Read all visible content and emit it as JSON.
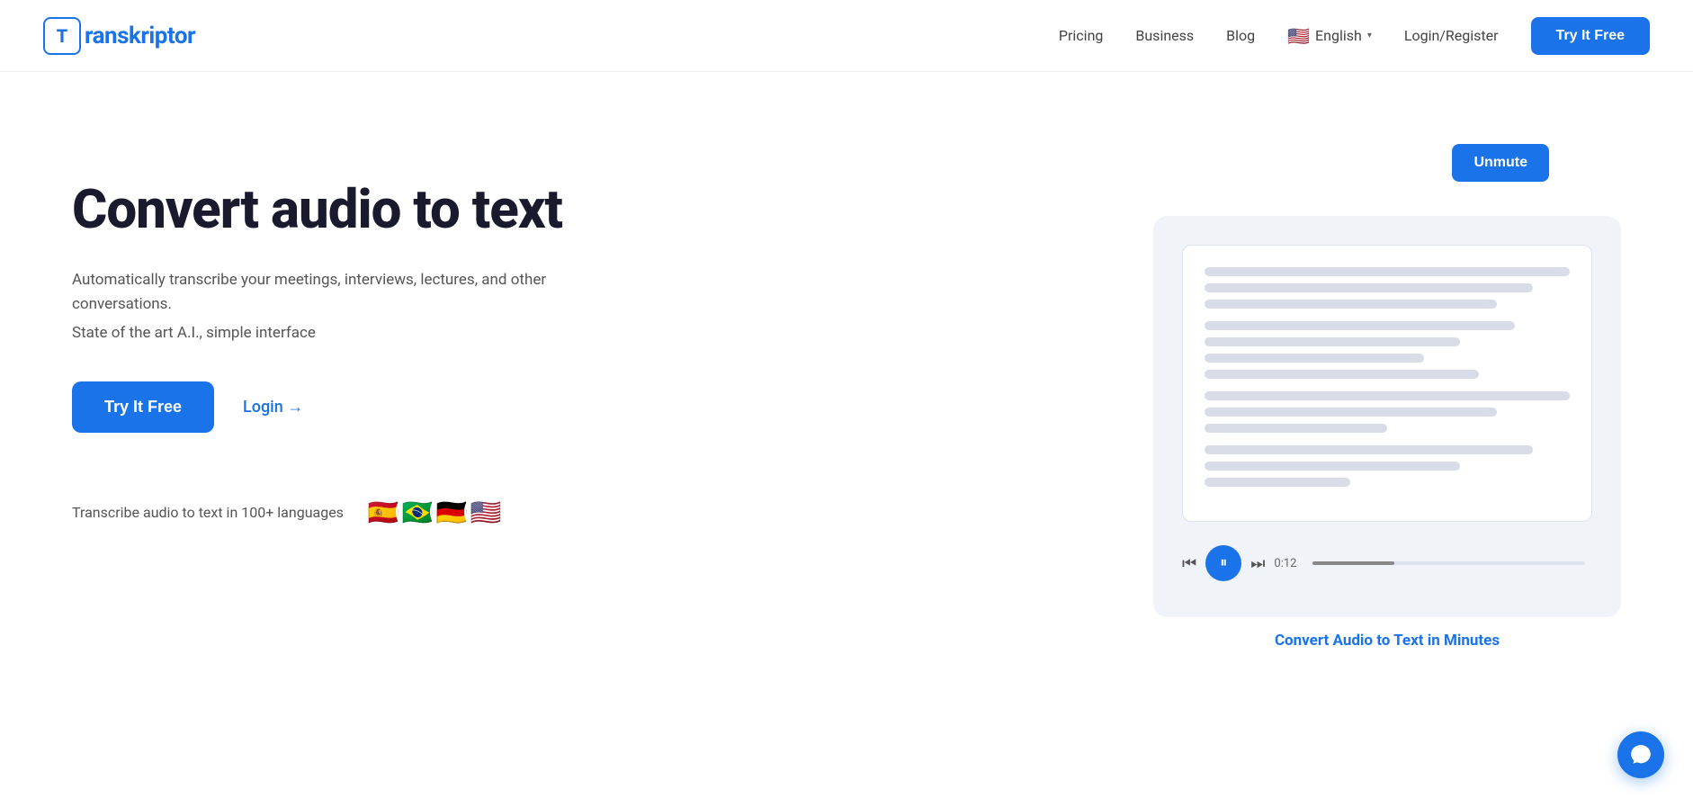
{
  "header": {
    "logo_letter": "T",
    "logo_name": "ranskriptor",
    "nav": {
      "pricing": "Pricing",
      "business": "Business",
      "blog": "Blog",
      "login_register": "Login/Register",
      "try_free": "Try It Free"
    },
    "language": {
      "label": "English",
      "chevron": "▾"
    }
  },
  "hero": {
    "title": "Convert audio to text",
    "subtitle": "Automatically transcribe your meetings, interviews, lectures, and other conversations.",
    "tagline": "State of the art A.I., simple interface",
    "try_btn": "Try It Free",
    "login_link": "Login →",
    "lang_text": "Transcribe audio to text in 100+ languages",
    "flags": [
      "🇪🇸",
      "🇧🇷",
      "🇩🇪",
      "🇺🇸"
    ]
  },
  "demo": {
    "unmute_btn": "Unmute",
    "caption": "Convert Audio to Text in Minutes"
  },
  "chat": {
    "icon": "chat-icon"
  }
}
